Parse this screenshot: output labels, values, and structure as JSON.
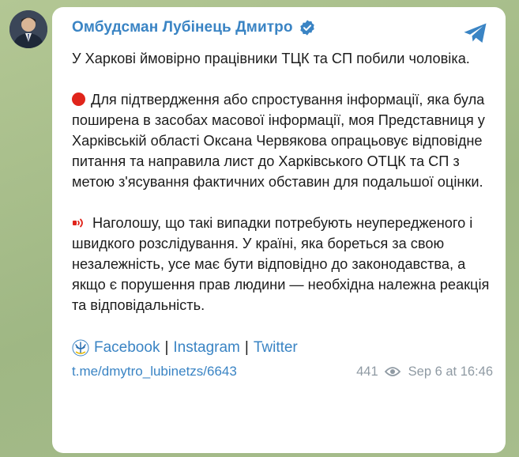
{
  "channel": {
    "name": "Омбудсман Лубінець Дмитро",
    "verified_icon": "verified-badge-icon",
    "share_icon": "telegram-share-icon"
  },
  "message": {
    "paragraph1": "У Харкові ймовірно працівники ТЦК та СП побили чоловіка.",
    "paragraph2": "Для підтвердження або спростування інформації, яка була поширена в засобах масової інформації, моя Представниця у Харківській області Оксана Червякова опрацьовує відповідне питання та направила лист до Харківського ОТЦК та СП з метою з'ясування фактичних обставин для подальшої оцінки.",
    "paragraph3": "Наголошу, що такі випадки потребують неупередженого і швидкого розслідування. У країні, яка бореться за свою незалежність, усе має бути відповідно до законодавства, а якщо є порушення прав людини — необхідна належна реакція та відповідальність."
  },
  "social": {
    "facebook": "Facebook",
    "instagram": "Instagram",
    "twitter": "Twitter",
    "separator": "|"
  },
  "footer": {
    "link": "t.me/dmytro_lubinetzs/6643",
    "views": "441",
    "date": "Sep 6 at 16:46"
  },
  "colors": {
    "accent": "#3a84c4",
    "red_dot": "#e0251b",
    "meta": "#8f9aa3"
  }
}
